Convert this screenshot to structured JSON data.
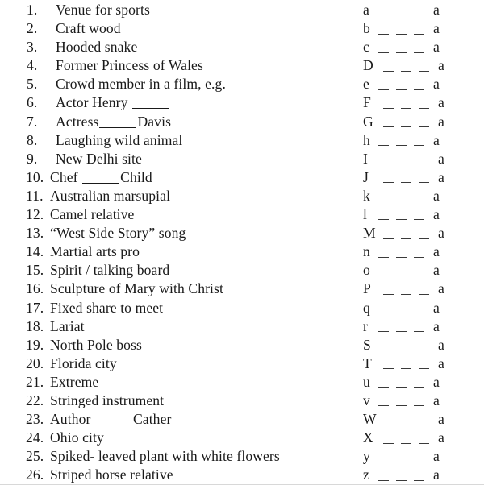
{
  "page": {
    "kind": "word-puzzle-worksheet",
    "background_color": "#ffffff",
    "text_color": "#1a1a1a",
    "blank_color": "#3a3a3a"
  },
  "answer_pattern": {
    "blank_count": 3,
    "end_letter": "a",
    "description": "Each answer begins with the shown letter and ends with the letter a"
  },
  "items": [
    {
      "number": "1.",
      "clue_parts": [
        {
          "type": "text",
          "value": "Venue for sports"
        }
      ],
      "start_letter": "a",
      "end_letter": "a"
    },
    {
      "number": "2.",
      "clue_parts": [
        {
          "type": "text",
          "value": "Craft wood"
        }
      ],
      "start_letter": "b",
      "end_letter": "a"
    },
    {
      "number": "3.",
      "clue_parts": [
        {
          "type": "text",
          "value": "Hooded snake"
        }
      ],
      "start_letter": "c",
      "end_letter": "a"
    },
    {
      "number": "4.",
      "clue_parts": [
        {
          "type": "text",
          "value": "Former Princess of Wales"
        }
      ],
      "start_letter": "D",
      "end_letter": "a"
    },
    {
      "number": "5.",
      "clue_parts": [
        {
          "type": "text",
          "value": "Crowd member in a film, e.g."
        }
      ],
      "start_letter": "e",
      "end_letter": "a"
    },
    {
      "number": "6.",
      "clue_parts": [
        {
          "type": "text",
          "value": "Actor Henry "
        },
        {
          "type": "blank",
          "value": ""
        }
      ],
      "start_letter": "F",
      "end_letter": "a"
    },
    {
      "number": "7.",
      "clue_parts": [
        {
          "type": "text",
          "value": "Actress"
        },
        {
          "type": "blank",
          "value": ""
        },
        {
          "type": "text",
          "value": "Davis"
        }
      ],
      "start_letter": "G",
      "end_letter": "a"
    },
    {
      "number": "8.",
      "clue_parts": [
        {
          "type": "text",
          "value": "Laughing wild animal"
        }
      ],
      "start_letter": "h",
      "end_letter": "a"
    },
    {
      "number": "9.",
      "clue_parts": [
        {
          "type": "text",
          "value": "New Delhi site"
        }
      ],
      "start_letter": "I",
      "end_letter": "a"
    },
    {
      "number": "10.",
      "clue_parts": [
        {
          "type": "text",
          "value": "Chef "
        },
        {
          "type": "blank",
          "value": ""
        },
        {
          "type": "text",
          "value": "Child"
        }
      ],
      "start_letter": "J",
      "end_letter": "a"
    },
    {
      "number": "11.",
      "clue_parts": [
        {
          "type": "text",
          "value": "Australian marsupial"
        }
      ],
      "start_letter": "k",
      "end_letter": "a"
    },
    {
      "number": "12.",
      "clue_parts": [
        {
          "type": "text",
          "value": "Camel relative"
        }
      ],
      "start_letter": "l",
      "end_letter": "a"
    },
    {
      "number": "13.",
      "clue_parts": [
        {
          "type": "text",
          "value": "“West Side Story” song"
        }
      ],
      "start_letter": "M",
      "end_letter": "a"
    },
    {
      "number": "14.",
      "clue_parts": [
        {
          "type": "text",
          "value": "Martial arts pro"
        }
      ],
      "start_letter": "n",
      "end_letter": "a"
    },
    {
      "number": "15.",
      "clue_parts": [
        {
          "type": "text",
          "value": "Spirit / talking board"
        }
      ],
      "start_letter": "o",
      "end_letter": "a"
    },
    {
      "number": "16.",
      "clue_parts": [
        {
          "type": "text",
          "value": "Sculpture of Mary with Christ"
        }
      ],
      "start_letter": "P",
      "end_letter": "a"
    },
    {
      "number": "17.",
      "clue_parts": [
        {
          "type": "text",
          "value": "Fixed share to meet"
        }
      ],
      "start_letter": "q",
      "end_letter": "a"
    },
    {
      "number": "18.",
      "clue_parts": [
        {
          "type": "text",
          "value": "Lariat"
        }
      ],
      "start_letter": "r",
      "end_letter": "a"
    },
    {
      "number": "19.",
      "clue_parts": [
        {
          "type": "text",
          "value": "North Pole boss"
        }
      ],
      "start_letter": "S",
      "end_letter": "a"
    },
    {
      "number": "20.",
      "clue_parts": [
        {
          "type": "text",
          "value": "Florida city"
        }
      ],
      "start_letter": "T",
      "end_letter": "a"
    },
    {
      "number": "21.",
      "clue_parts": [
        {
          "type": "text",
          "value": "Extreme"
        }
      ],
      "start_letter": "u",
      "end_letter": "a"
    },
    {
      "number": "22.",
      "clue_parts": [
        {
          "type": "text",
          "value": "Stringed instrument"
        }
      ],
      "start_letter": "v",
      "end_letter": "a"
    },
    {
      "number": "23.",
      "clue_parts": [
        {
          "type": "text",
          "value": "Author "
        },
        {
          "type": "blank",
          "value": ""
        },
        {
          "type": "text",
          "value": "Cather"
        }
      ],
      "start_letter": "W",
      "end_letter": "a"
    },
    {
      "number": "24.",
      "clue_parts": [
        {
          "type": "text",
          "value": "Ohio city"
        }
      ],
      "start_letter": "X",
      "end_letter": "a"
    },
    {
      "number": "25.",
      "clue_parts": [
        {
          "type": "text",
          "value": "Spiked- leaved plant with white flowers"
        }
      ],
      "start_letter": "y",
      "end_letter": "a"
    },
    {
      "number": "26.",
      "clue_parts": [
        {
          "type": "text",
          "value": "Striped horse relative"
        }
      ],
      "start_letter": "z",
      "end_letter": "a"
    }
  ]
}
